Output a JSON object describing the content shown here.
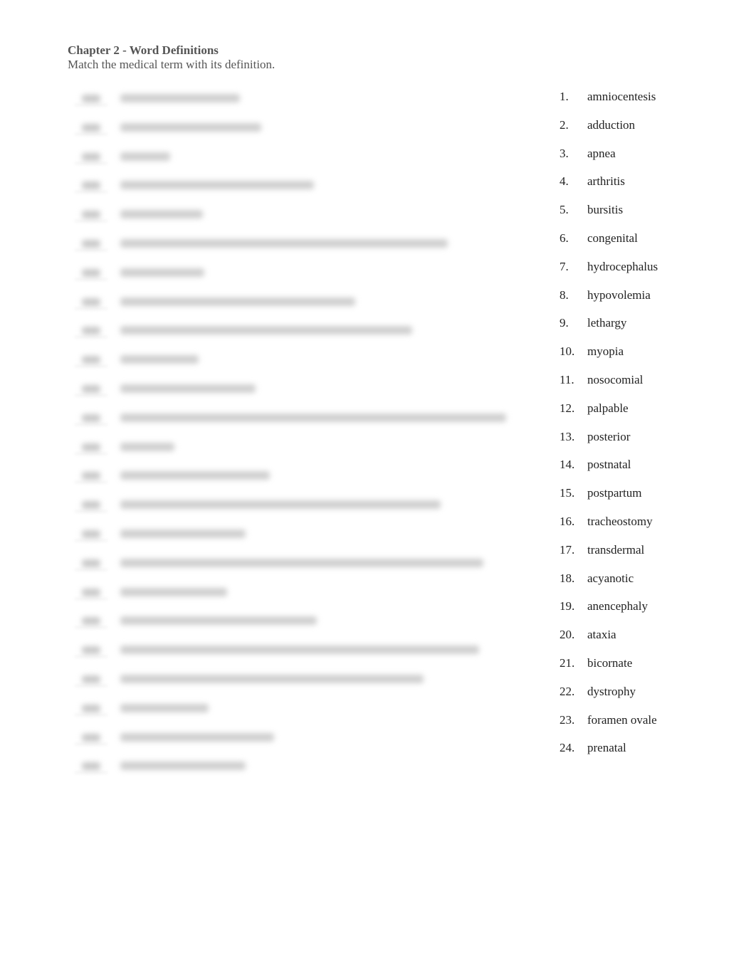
{
  "header": {
    "title": "Chapter 2 - Word Definitions",
    "subtitle": "Match the medical term with its definition."
  },
  "definitions": [
    {
      "text": "[blurred]",
      "len": 168
    },
    {
      "text": "[blurred]",
      "len": 198
    },
    {
      "text": "[blurred]",
      "len": 70
    },
    {
      "text": "[blurred]",
      "len": 272
    },
    {
      "text": "[blurred]",
      "len": 116
    },
    {
      "text": "[blurred]",
      "len": 460
    },
    {
      "text": "[blurred]",
      "len": 118
    },
    {
      "text": "[blurred]",
      "len": 330
    },
    {
      "text": "[blurred]",
      "len": 410
    },
    {
      "text": "[blurred]",
      "len": 110
    },
    {
      "text": "[blurred]",
      "len": 190
    },
    {
      "text": "[blurred]",
      "len": 542
    },
    {
      "text": "[blurred]",
      "len": 76
    },
    {
      "text": "[blurred]",
      "len": 210
    },
    {
      "text": "[blurred]",
      "len": 450
    },
    {
      "text": "[blurred]",
      "len": 176
    },
    {
      "text": "[blurred]",
      "len": 510
    },
    {
      "text": "[blurred]",
      "len": 150
    },
    {
      "text": "[blurred]",
      "len": 276
    },
    {
      "text": "[blurred]",
      "len": 504
    },
    {
      "text": "[blurred]",
      "len": 426
    },
    {
      "text": "[blurred]",
      "len": 124
    },
    {
      "text": "[blurred]",
      "len": 216
    },
    {
      "text": "[blurred]",
      "len": 176
    }
  ],
  "terms": [
    {
      "num": "1.",
      "term": "amniocentesis"
    },
    {
      "num": "2.",
      "term": "adduction"
    },
    {
      "num": "3.",
      "term": "apnea"
    },
    {
      "num": "4.",
      "term": "arthritis"
    },
    {
      "num": "5.",
      "term": "bursitis"
    },
    {
      "num": "6.",
      "term": "congenital"
    },
    {
      "num": "7.",
      "term": "hydrocephalus"
    },
    {
      "num": "8.",
      "term": "hypovolemia"
    },
    {
      "num": "9.",
      "term": "lethargy"
    },
    {
      "num": "10.",
      "term": "myopia"
    },
    {
      "num": "11.",
      "term": "nosocomial"
    },
    {
      "num": "12.",
      "term": "palpable"
    },
    {
      "num": "13.",
      "term": "posterior"
    },
    {
      "num": "14.",
      "term": "postnatal"
    },
    {
      "num": "15.",
      "term": "postpartum"
    },
    {
      "num": "16.",
      "term": "tracheostomy"
    },
    {
      "num": "17.",
      "term": "transdermal"
    },
    {
      "num": "18.",
      "term": "acyanotic"
    },
    {
      "num": "19.",
      "term": "anencephaly"
    },
    {
      "num": "20.",
      "term": "ataxia"
    },
    {
      "num": "21.",
      "term": "bicornate"
    },
    {
      "num": "22.",
      "term": "dystrophy"
    },
    {
      "num": "23.",
      "term": "foramen ovale"
    },
    {
      "num": "24.",
      "term": "prenatal"
    }
  ]
}
